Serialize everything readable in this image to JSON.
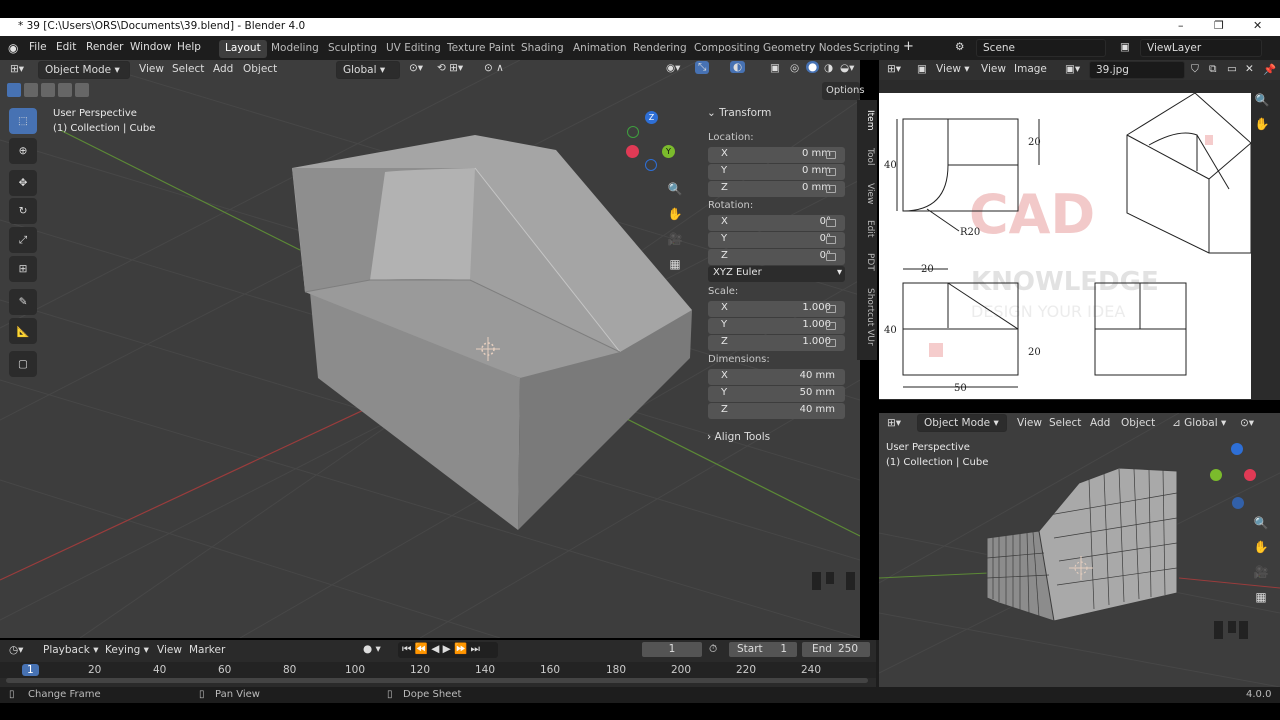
{
  "window": {
    "title": "* 39 [C:\\Users\\ORS\\Documents\\39.blend] - Blender 4.0",
    "minimize": "–",
    "maximize": "❐",
    "close": "✕"
  },
  "menu": [
    "File",
    "Edit",
    "Render",
    "Window",
    "Help"
  ],
  "workspaces": [
    "Layout",
    "Modeling",
    "Sculpting",
    "UV Editing",
    "Texture Paint",
    "Shading",
    "Animation",
    "Rendering",
    "Compositing",
    "Geometry Nodes",
    "Scripting"
  ],
  "active_workspace": "Layout",
  "scene": "Scene",
  "view_layer": "ViewLayer",
  "viewport": {
    "mode": "Object Mode",
    "menu": [
      "View",
      "Select",
      "Add",
      "Object"
    ],
    "orientation": "Global",
    "options": "Options",
    "perspective": "User Perspective",
    "collection": "(1) Collection | Cube",
    "gizmo": {
      "z": "Z",
      "y": "Y"
    }
  },
  "transform": {
    "title": "Transform",
    "location_label": "Location:",
    "location": [
      {
        "axis": "X",
        "value": "0 mm"
      },
      {
        "axis": "Y",
        "value": "0 mm"
      },
      {
        "axis": "Z",
        "value": "0 mm"
      }
    ],
    "rotation_label": "Rotation:",
    "rotation": [
      {
        "axis": "X",
        "value": "0°"
      },
      {
        "axis": "Y",
        "value": "0°"
      },
      {
        "axis": "Z",
        "value": "0°"
      }
    ],
    "rotation_mode": "XYZ Euler",
    "scale_label": "Scale:",
    "scale": [
      {
        "axis": "X",
        "value": "1.000"
      },
      {
        "axis": "Y",
        "value": "1.000"
      },
      {
        "axis": "Z",
        "value": "1.000"
      }
    ],
    "dimensions_label": "Dimensions:",
    "dimensions": [
      {
        "axis": "X",
        "value": "40 mm"
      },
      {
        "axis": "Y",
        "value": "50 mm"
      },
      {
        "axis": "Z",
        "value": "40 mm"
      }
    ],
    "align_tools": "Align Tools"
  },
  "side_tabs": [
    "Item",
    "Tool",
    "View",
    "Edit",
    "PDT",
    "Shortcut VUr"
  ],
  "image_editor": {
    "menu": [
      "View",
      "View",
      "Image"
    ],
    "image_name": "39.jpg",
    "drawing": {
      "dim_40a": "40",
      "dim_20a": "20",
      "dim_r20": "R20",
      "dim_20b": "20",
      "dim_40b": "40",
      "dim_20c": "20",
      "dim_50": "50",
      "watermark_1": "CAD",
      "watermark_2": "KNOWLEDGE",
      "watermark_3": "DESIGN YOUR IDEA"
    }
  },
  "viewport2": {
    "mode": "Object Mode",
    "menu": [
      "View",
      "Select",
      "Add",
      "Object"
    ],
    "orientation": "Global",
    "perspective": "User Perspective",
    "collection": "(1) Collection | Cube"
  },
  "timeline": {
    "menu": [
      "Playback",
      "Keying",
      "View",
      "Marker"
    ],
    "current_frame": "1",
    "start_label": "Start",
    "start": "1",
    "end_label": "End",
    "end": "250",
    "ticks": [
      "1",
      "20",
      "40",
      "60",
      "80",
      "100",
      "120",
      "140",
      "160",
      "180",
      "200",
      "220",
      "240"
    ]
  },
  "status": {
    "change_frame": "Change Frame",
    "pan_view": "Pan View",
    "dope_sheet": "Dope Sheet",
    "version": "4.0.0"
  }
}
